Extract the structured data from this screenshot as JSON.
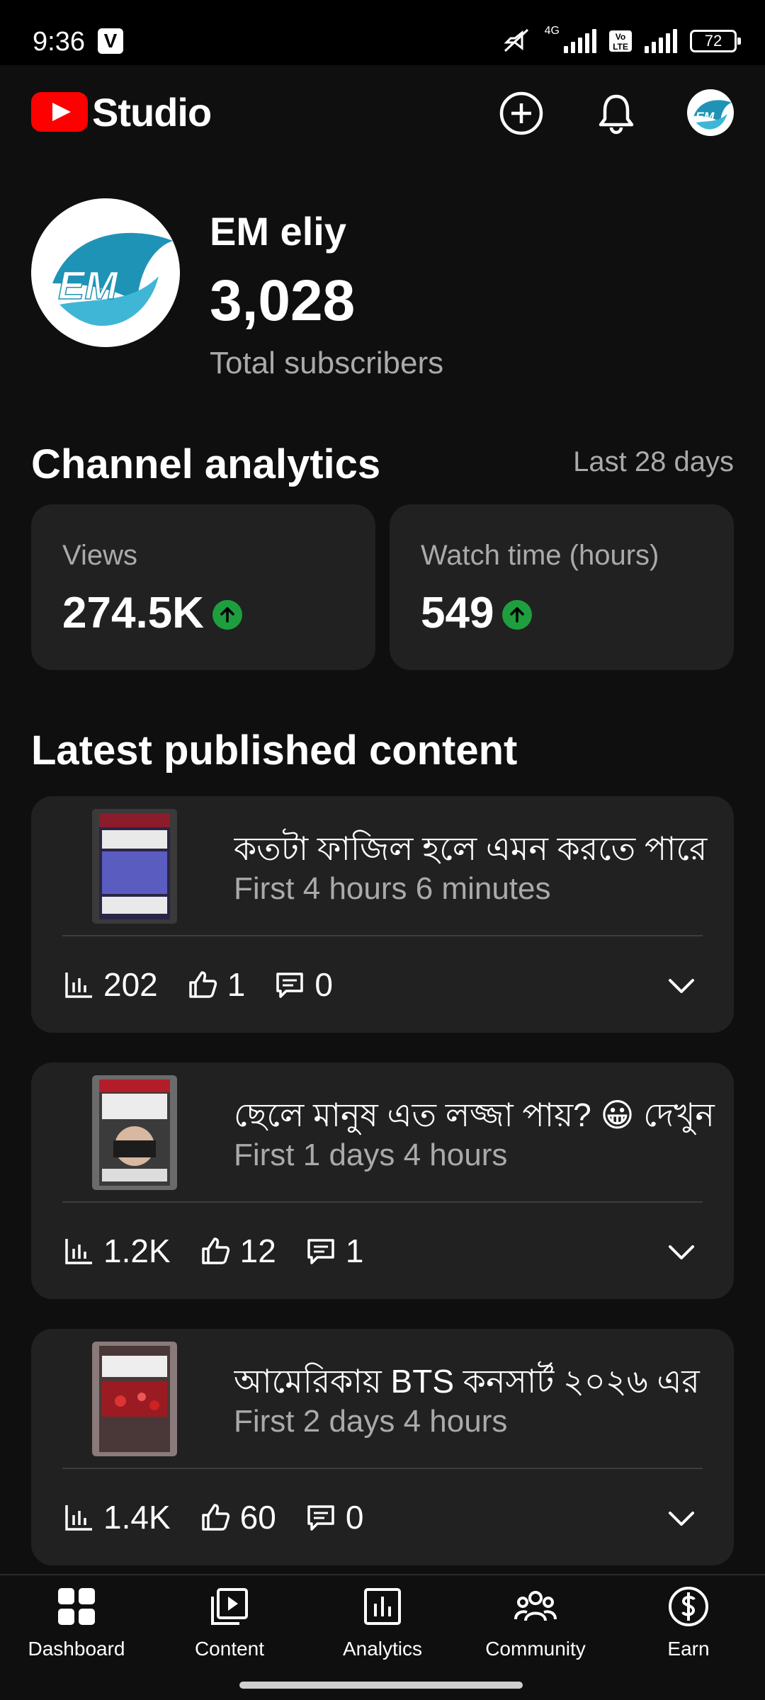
{
  "status_bar": {
    "time": "9:36",
    "badge": "V",
    "network": "4G",
    "volte": "Vo LTE",
    "battery": "72"
  },
  "app_bar": {
    "brand": "Studio"
  },
  "channel": {
    "name": "EM eliy",
    "subscribers": "3,028",
    "subscribers_label": "Total subscribers",
    "avatar_text": "EM"
  },
  "analytics": {
    "title": "Channel analytics",
    "period": "Last 28 days",
    "metrics": [
      {
        "label": "Views",
        "value": "274.5K"
      },
      {
        "label": "Watch time (hours)",
        "value": "549"
      }
    ]
  },
  "latest": {
    "title": "Latest published content",
    "items": [
      {
        "title": "কতটা ফাজিল হলে এমন করতে পারে",
        "subtitle": "First 4 hours 6 minutes",
        "views": "202",
        "likes": "1",
        "comments": "0"
      },
      {
        "title": "ছেলে মানুষ এত লজ্জা পায়? 😀 দেখুন",
        "subtitle": "First 1 days 4 hours",
        "views": "1.2K",
        "likes": "12",
        "comments": "1"
      },
      {
        "title": "আমেরিকায় BTS কনসার্ট ২০২৬ এর",
        "subtitle": "First 2 days 4 hours",
        "views": "1.4K",
        "likes": "60",
        "comments": "0"
      }
    ]
  },
  "nav": {
    "items": [
      {
        "label": "Dashboard"
      },
      {
        "label": "Content"
      },
      {
        "label": "Analytics"
      },
      {
        "label": "Community"
      },
      {
        "label": "Earn"
      }
    ]
  }
}
